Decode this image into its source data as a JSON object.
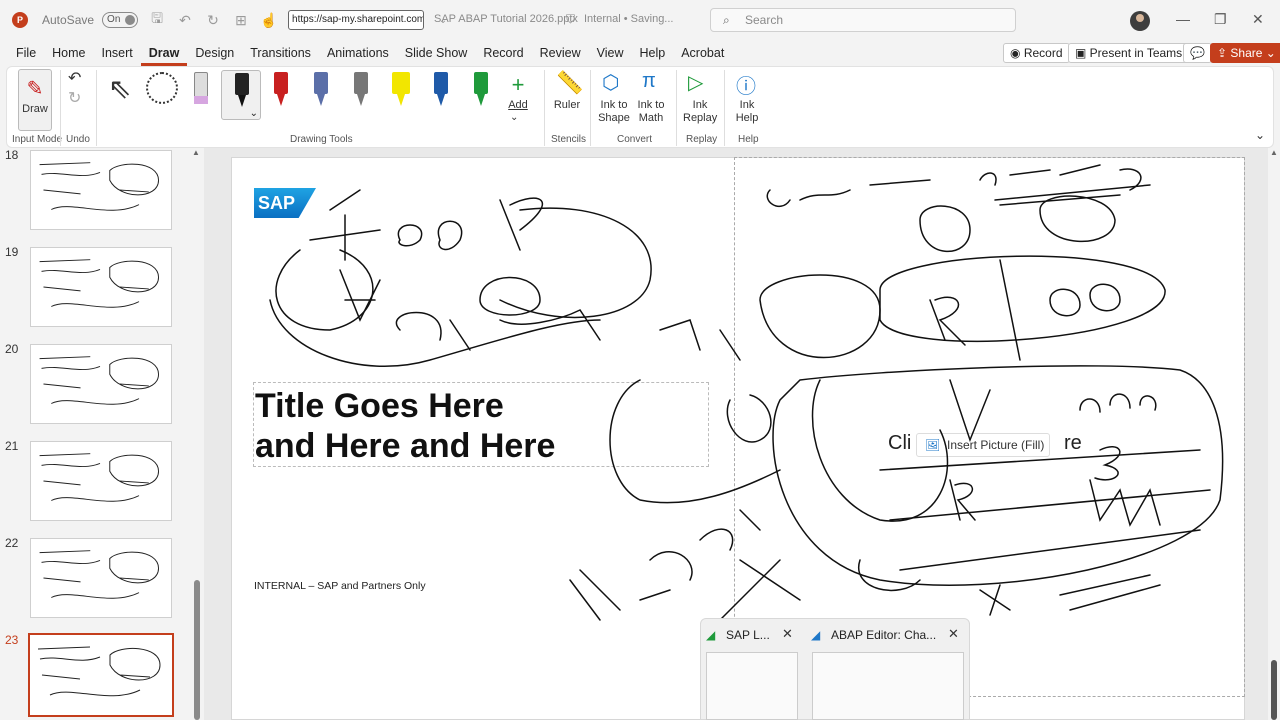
{
  "titlebar": {
    "app_icon": "P",
    "autosave_label": "AutoSave",
    "autosave_state": "On",
    "url": "https://sap-my.sharepoint.com/",
    "document_title": "SAP ABAP Tutorial 2026.pptx",
    "sensitivity": "Internal",
    "save_status": "Saving...",
    "search_placeholder": "Search"
  },
  "menu": [
    "File",
    "Home",
    "Insert",
    "Draw",
    "Design",
    "Transitions",
    "Animations",
    "Slide Show",
    "Record",
    "Review",
    "View",
    "Help",
    "Acrobat"
  ],
  "active_tab": "Draw",
  "right_buttons": {
    "record": "Record",
    "present": "Present in Teams",
    "share": "Share"
  },
  "ribbon": {
    "draw_label": "Draw",
    "add_label": "Add",
    "ruler_label": "Ruler",
    "ink_to_shape": "Ink to Shape",
    "ink_to_math": "Ink to Math",
    "ink_replay": "Ink Replay",
    "ink_help": "Ink Help",
    "groups": {
      "input_mode": "Input Mode",
      "undo": "Undo",
      "drawing_tools": "Drawing Tools",
      "stencils": "Stencils",
      "convert": "Convert",
      "replay": "Replay",
      "help": "Help"
    },
    "pen_colors": [
      "#c82020",
      "#5b6fa8",
      "#777777",
      "#f2e600",
      "#1f5aa8",
      "#1f9a3b"
    ]
  },
  "slides": [
    {
      "number": "18"
    },
    {
      "number": "19"
    },
    {
      "number": "20"
    },
    {
      "number": "21"
    },
    {
      "number": "22"
    },
    {
      "number": "23",
      "selected": true
    }
  ],
  "slide": {
    "logo_text": "SAP",
    "title_line1": "Title Goes Here",
    "title_line2": "and Here and Here",
    "footer": "INTERNAL – SAP and Partners Only",
    "picture_prefix": "Cli",
    "insert_picture": "Insert Picture (Fill)",
    "picture_suffix": "re"
  },
  "taskbar_preview": [
    {
      "title": "SAP L..."
    },
    {
      "title": "ABAP Editor: Cha..."
    }
  ]
}
